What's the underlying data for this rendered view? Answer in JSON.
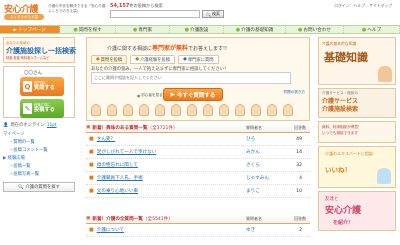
{
  "header": {
    "logo_main": "安心介護",
    "logo_sub": "ふくろうのちえ袋",
    "tagline": "介護の不安を解決できる「安心介護 ふくろうのちえ袋」",
    "search_count_num": "54,157",
    "search_count_text": "件の投稿から検索",
    "search_placeholder": "",
    "search_label": "検索",
    "links": [
      "ログイン",
      "ヘルプ",
      "サイトマップ"
    ]
  },
  "nav": {
    "items": [
      {
        "label": "トップページ",
        "active": true
      },
      {
        "label": "質問を探す",
        "active": false
      },
      {
        "label": "専門家",
        "active": false
      },
      {
        "label": "介護施設",
        "active": false
      },
      {
        "label": "介護の基礎知識",
        "active": false
      },
      {
        "label": "お問い合わせ",
        "active": false
      },
      {
        "label": "ヘルプ",
        "active": false
      }
    ]
  },
  "left": {
    "feature_small": "あなたの地域の",
    "feature_big": "介護施設探し一括検索",
    "feature_desc": "特養 老健 有料老人ホームなど",
    "member_title": "〇〇さん",
    "ask_btn_small": "専門家に",
    "ask_btn_label": "質問する",
    "post_btn_small": "経験広場に",
    "post_btn_label": "投稿する",
    "online_label": "現在のオンライン",
    "online_count": "11pt",
    "links": [
      {
        "label": "マイページ",
        "sub": false
      },
      {
        "label": "・質問の一覧",
        "sub": true
      },
      {
        "label": "・投稿コメント一覧",
        "sub": true
      },
      {
        "label": "▶ 経験広場",
        "sub": false
      },
      {
        "label": "・投稿一覧",
        "sub": true
      },
      {
        "label": "・投稿写真一覧",
        "sub": true
      }
    ],
    "care_box": "介護の質問を探す"
  },
  "ask": {
    "head_prefix": "介護に関する相談に",
    "head_highlight": "専門家が無料",
    "head_suffix": "でお答えします!!",
    "tabs": [
      "質問を投稿",
      "介護経験を投稿",
      "専門家に質問"
    ],
    "prompt": "あなたの介護の悩み、一人で抱え込まずに専門家に相談してください！",
    "placeholder": "ここに質問や相談を記入してください",
    "hint_label": "初心者を見る",
    "submit_label": "今すぐ質問する",
    "help_link": "質問の書き方"
  },
  "list1": {
    "title": "新着！興味のある質問一覧",
    "count": "（全3721件）",
    "col_user": "質問者名",
    "col_ans": "回答数",
    "rows": [
      {
        "title": "せん妄？",
        "user": "ひろ",
        "ans": "49"
      },
      {
        "title": "足がしびれて一人で歩けない",
        "user": "みかん",
        "ans": "14"
      },
      {
        "title": "母の物忘れに関して",
        "user": "さくら",
        "ans": "32"
      },
      {
        "title": "介護職員下人氏、手術",
        "user": "じゃすみん",
        "ans": "4"
      },
      {
        "title": "父の乗り心地いい車",
        "user": "まりこ",
        "ans": "10"
      }
    ]
  },
  "list2": {
    "title": "新着！介護の全質問一覧",
    "count": "（全5541件）",
    "col_user": "質問者名",
    "col_ans": "回答数",
    "rows": [
      {
        "title": "介護について",
        "user": "ゆき",
        "ans": "2"
      }
    ]
  },
  "right": {
    "b1_small": "介護の基本的な知識",
    "b1_big": "基礎知識",
    "b2_small": "介護サービス・施設の",
    "b2_mid1": "介護サービス",
    "b2_mid2": "介護施設検索",
    "b3_small": "無料、利用相談が得意！",
    "b3_small2": "いつでも相談できます",
    "b4_small": "介護のエキスパートに相談",
    "b4_mid": "いいね！",
    "b5_small": "友達と",
    "b5_big": "安心介護",
    "b5_small2": "を紹介！"
  }
}
